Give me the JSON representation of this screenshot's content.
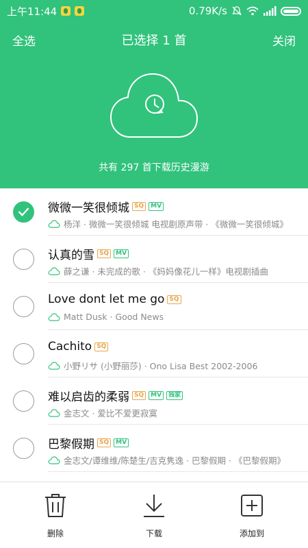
{
  "status_bar": {
    "time": "上午11:44",
    "network_speed": "0.79K/s"
  },
  "header": {
    "select_all": "全选",
    "title": "已选择 1 首",
    "close": "关闭",
    "history_text": "共有 297 首下载历史漫游"
  },
  "songs": [
    {
      "title": "微微一笑很倾城",
      "tags": [
        "SQ",
        "MV"
      ],
      "subtitle": "杨洋 · 微微一笑很倾城 电视剧原声带 · 《微微一笑很倾城》",
      "checked": true
    },
    {
      "title": "认真的雪",
      "tags": [
        "SQ",
        "MV"
      ],
      "subtitle": "薛之谦 · 未完成的歌 · 《妈妈像花儿一样》电视剧插曲",
      "checked": false
    },
    {
      "title": "Love dont let me go",
      "tags": [
        "SQ"
      ],
      "subtitle": "Matt Dusk · Good News",
      "checked": false
    },
    {
      "title": "Cachito",
      "tags": [
        "SQ"
      ],
      "subtitle": "小野リサ (小野丽莎) · Ono Lisa Best 2002-2006",
      "checked": false
    },
    {
      "title": "难以启齿的柔弱",
      "tags": [
        "SQ",
        "MV",
        "独家"
      ],
      "subtitle": "金志文 · 爱比不爱更寂寞",
      "checked": false
    },
    {
      "title": "巴黎假期",
      "tags": [
        "SQ",
        "MV"
      ],
      "subtitle": "金志文/谭维维/陈楚生/吉克隽逸 · 巴黎假期 · 《巴黎假期》",
      "checked": false
    }
  ],
  "actions": {
    "delete": "删除",
    "download": "下载",
    "add_to": "添加到"
  },
  "colors": {
    "accent": "#31c27c",
    "sq_tag": "#e8a54a"
  },
  "icons": [
    "clock-cloud-icon",
    "checkmark-icon",
    "cloud-icon",
    "trash-icon",
    "download-icon",
    "add-box-icon"
  ]
}
